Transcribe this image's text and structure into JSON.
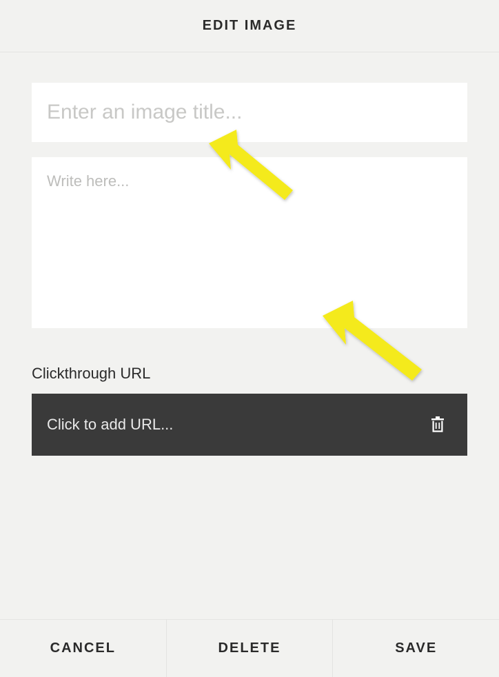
{
  "header": {
    "title": "EDIT IMAGE"
  },
  "form": {
    "title_placeholder": "Enter an image title...",
    "title_value": "",
    "description_placeholder": "Write here...",
    "description_value": "",
    "clickthrough_label": "Clickthrough URL",
    "url_placeholder": "Click to add URL...",
    "url_value": ""
  },
  "footer": {
    "cancel": "CANCEL",
    "delete": "DELETE",
    "save": "SAVE"
  },
  "annotations": {
    "arrow_color": "#f4ea1a"
  }
}
